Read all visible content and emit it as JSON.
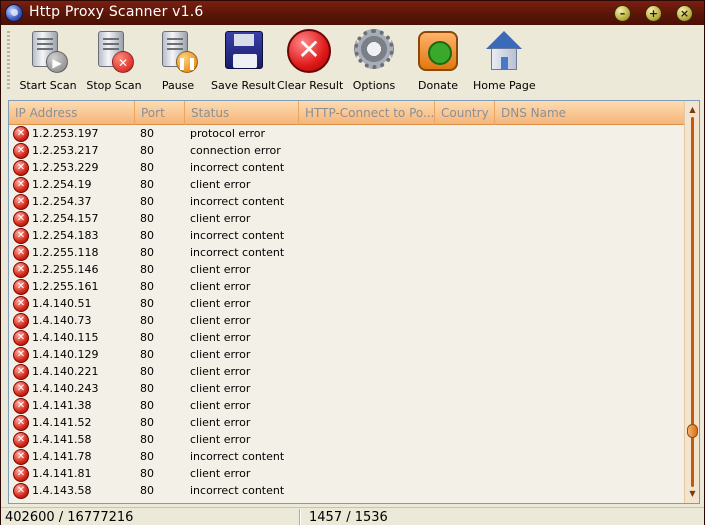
{
  "window": {
    "title": "Http Proxy Scanner v1.6"
  },
  "toolbar": {
    "buttons": [
      {
        "label": "Start Scan"
      },
      {
        "label": "Stop Scan"
      },
      {
        "label": "Pause"
      },
      {
        "label": "Save Result"
      },
      {
        "label": "Clear Result"
      },
      {
        "label": "Options"
      },
      {
        "label": "Donate"
      },
      {
        "label": "Home Page"
      }
    ]
  },
  "table": {
    "columns": [
      "IP Address",
      "Port",
      "Status",
      "HTTP-Connect to Po...",
      "Country",
      "DNS Name"
    ],
    "rows": [
      {
        "ip": "1.2.253.197",
        "port": "80",
        "status": "protocol error"
      },
      {
        "ip": "1.2.253.217",
        "port": "80",
        "status": "connection error"
      },
      {
        "ip": "1.2.253.229",
        "port": "80",
        "status": "incorrect content"
      },
      {
        "ip": "1.2.254.19",
        "port": "80",
        "status": "client error"
      },
      {
        "ip": "1.2.254.37",
        "port": "80",
        "status": "incorrect content"
      },
      {
        "ip": "1.2.254.157",
        "port": "80",
        "status": "client error"
      },
      {
        "ip": "1.2.254.183",
        "port": "80",
        "status": "incorrect content"
      },
      {
        "ip": "1.2.255.118",
        "port": "80",
        "status": "incorrect content"
      },
      {
        "ip": "1.2.255.146",
        "port": "80",
        "status": "client error"
      },
      {
        "ip": "1.2.255.161",
        "port": "80",
        "status": "client error"
      },
      {
        "ip": "1.4.140.51",
        "port": "80",
        "status": "client error"
      },
      {
        "ip": "1.4.140.73",
        "port": "80",
        "status": "client error"
      },
      {
        "ip": "1.4.140.115",
        "port": "80",
        "status": "client error"
      },
      {
        "ip": "1.4.140.129",
        "port": "80",
        "status": "client error"
      },
      {
        "ip": "1.4.140.221",
        "port": "80",
        "status": "client error"
      },
      {
        "ip": "1.4.140.243",
        "port": "80",
        "status": "client error"
      },
      {
        "ip": "1.4.141.38",
        "port": "80",
        "status": "client error"
      },
      {
        "ip": "1.4.141.52",
        "port": "80",
        "status": "client error"
      },
      {
        "ip": "1.4.141.58",
        "port": "80",
        "status": "client error"
      },
      {
        "ip": "1.4.141.78",
        "port": "80",
        "status": "incorrect content"
      },
      {
        "ip": "1.4.141.81",
        "port": "80",
        "status": "client error"
      },
      {
        "ip": "1.4.143.58",
        "port": "80",
        "status": "incorrect content"
      }
    ]
  },
  "statusbar": {
    "progress": "402600 / 16777216",
    "found": "1457 / 1536"
  },
  "colors": {
    "titlebar": "#5a1508",
    "header": "#f6b57a",
    "error_icon": "#d42818"
  },
  "icons": {
    "row_status": "error-x-icon"
  }
}
